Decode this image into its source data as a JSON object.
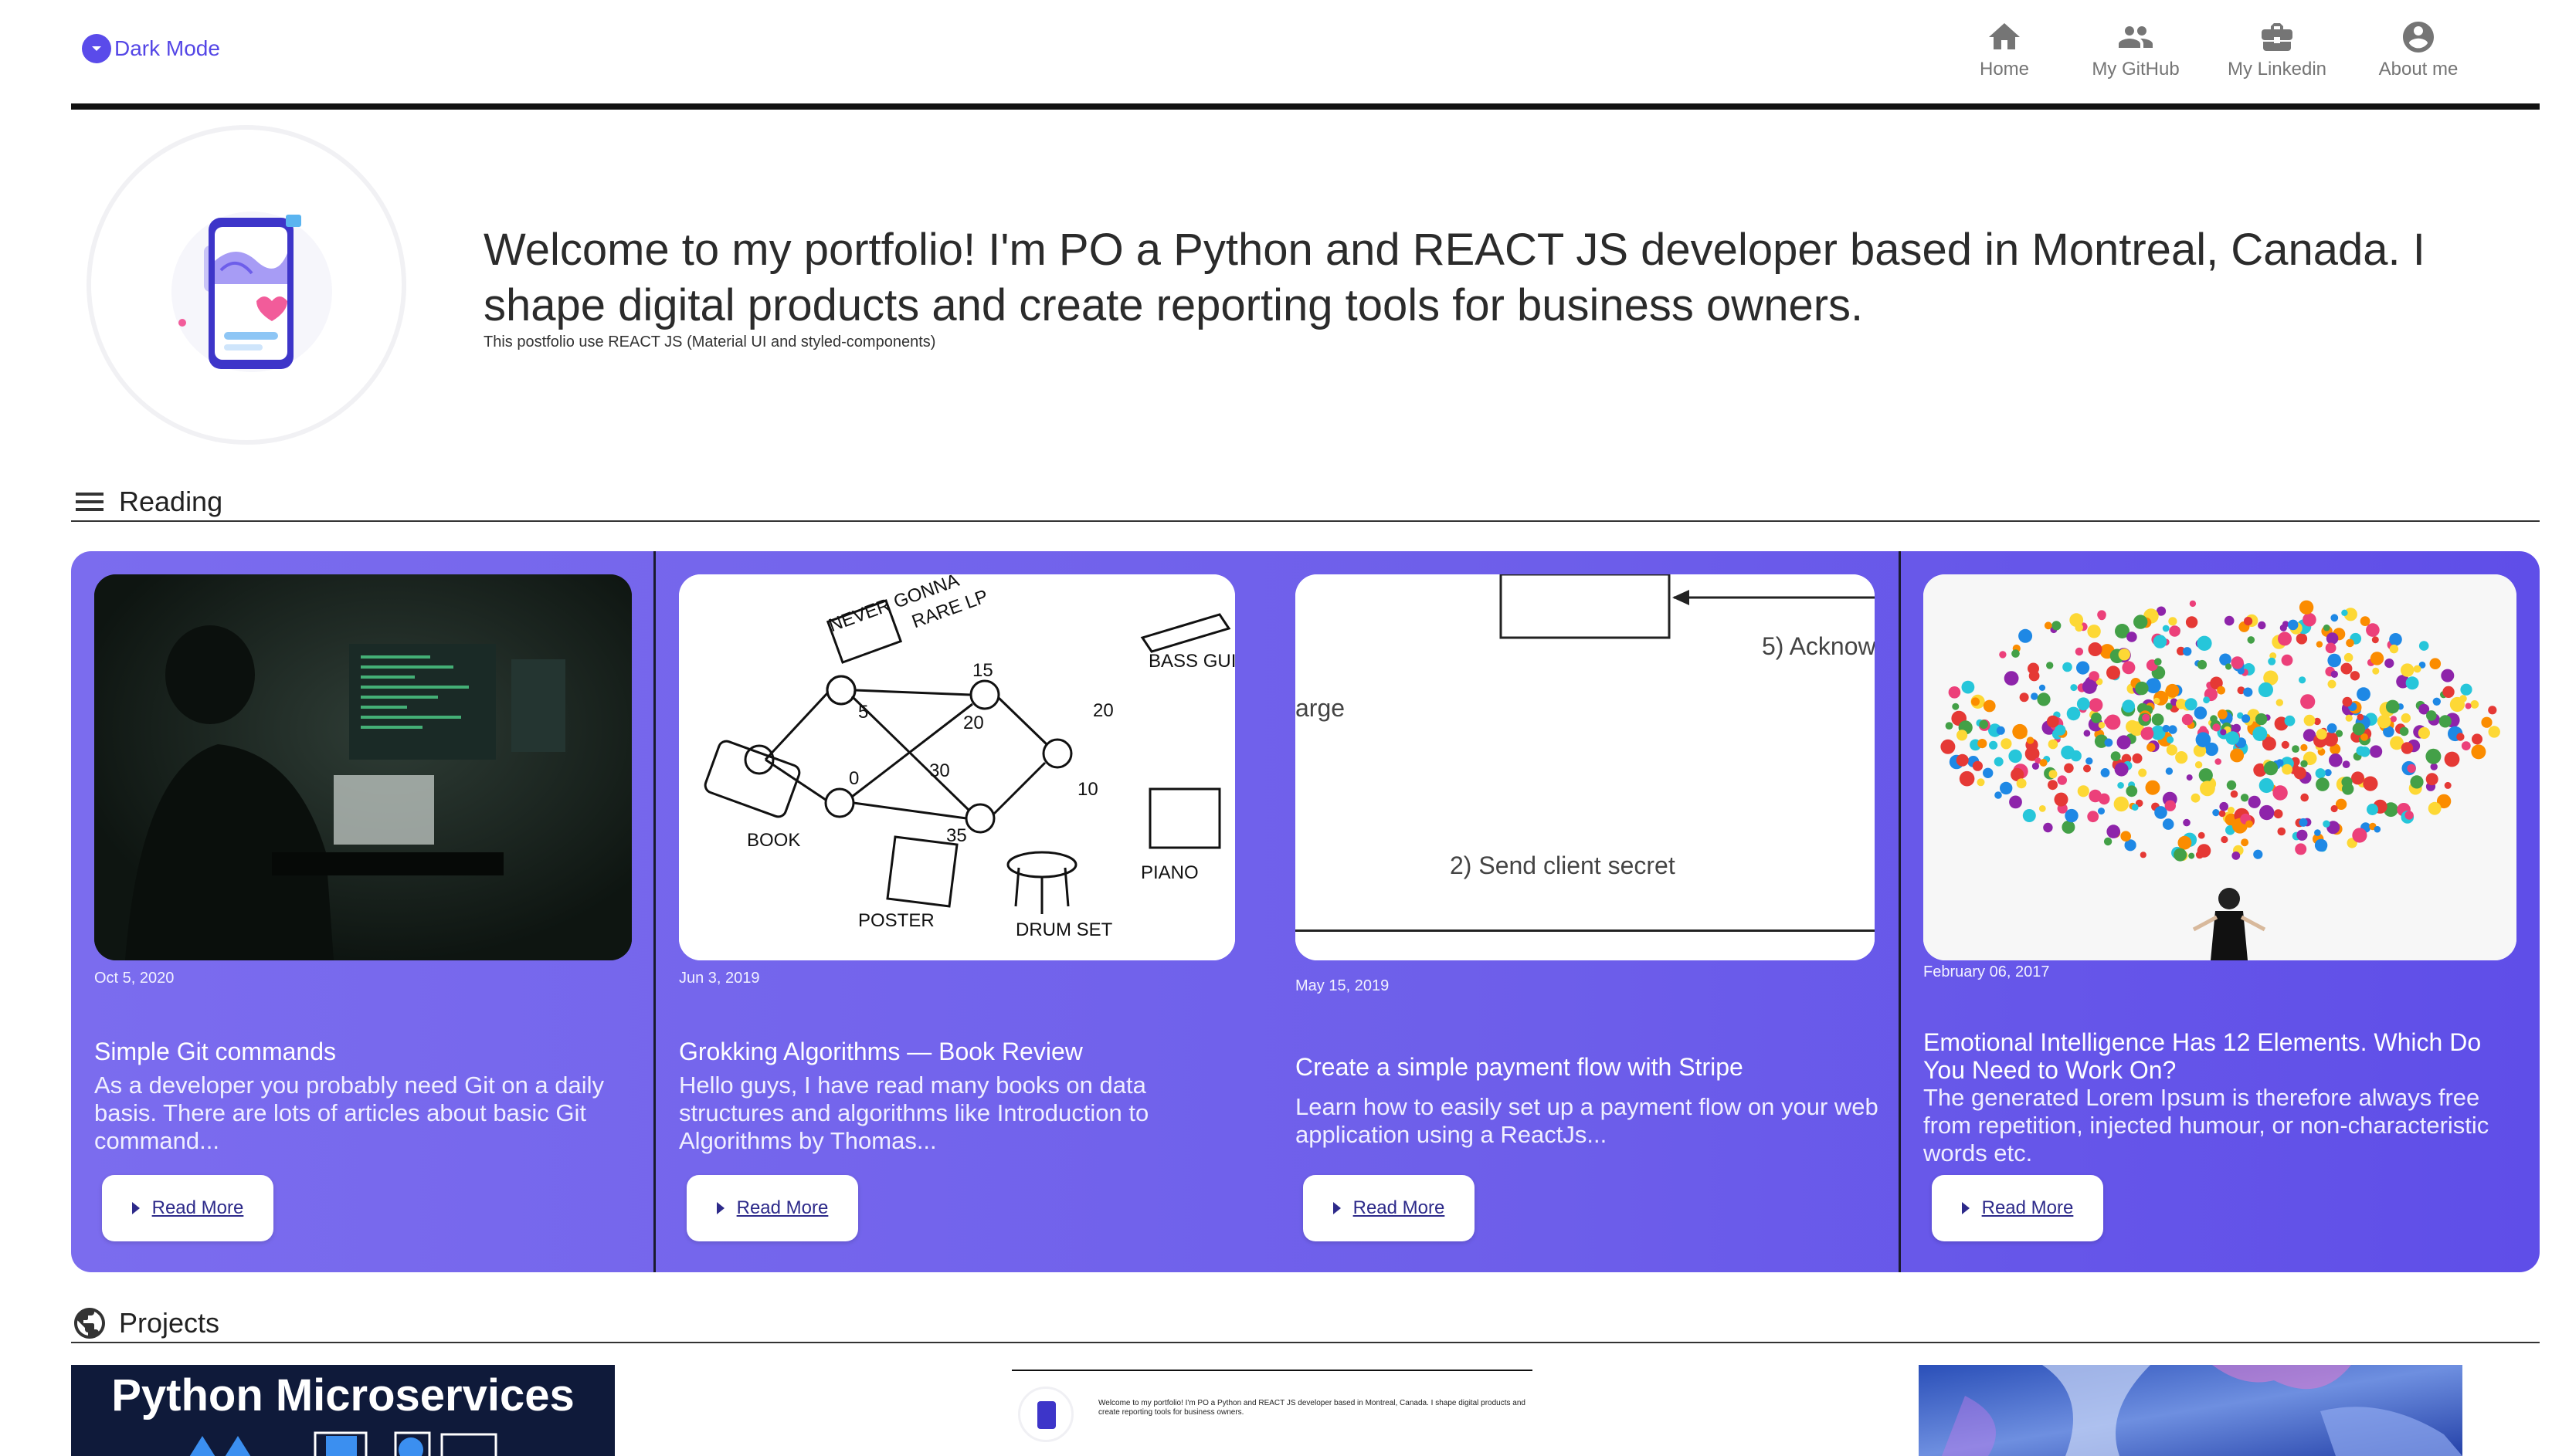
{
  "header": {
    "dark_mode_label": "Dark Mode",
    "nav": [
      {
        "label": "Home",
        "icon": "home-icon"
      },
      {
        "label": "My GitHub",
        "icon": "people-icon"
      },
      {
        "label": "My Linkedin",
        "icon": "briefcase-icon"
      },
      {
        "label": "About me",
        "icon": "account-circle-icon"
      }
    ]
  },
  "hero": {
    "title": "Welcome to my portfolio! I'm PO a Python and REACT JS developer based in Montreal, Canada. I shape digital products and create reporting tools for business owners.",
    "subtitle": "This postfolio use REACT JS (Material UI and styled-components)"
  },
  "reading": {
    "section_title": "Reading",
    "cards": [
      {
        "date": "Oct 5, 2020",
        "title": "Simple Git commands",
        "description": "As a developer you probably need Git on a daily basis. There are lots of articles about basic Git command...",
        "button": "Read More"
      },
      {
        "date": "Jun 3, 2019",
        "title": "Grokking Algorithms — Book Review",
        "description": "Hello guys, I have read many books on data structures and algorithms like Introduction to Algorithms by Thomas...",
        "button": "Read More",
        "image_text": [
          "NEVER GONNA",
          "RARE LP",
          "BASS GUITAR",
          "15",
          "5",
          "20",
          "20",
          "30",
          "0",
          "10",
          "35",
          "BOOK",
          "PIANO",
          "POSTER",
          "DRUM SET"
        ]
      },
      {
        "date": "May 15, 2019",
        "title": "Create a simple payment flow with Stripe",
        "description": "Learn how to easily set up a payment flow on your web application using a ReactJs...",
        "button": "Read More",
        "image_text": [
          "5) Acknow",
          "arge",
          "2) Send client secret"
        ]
      },
      {
        "date": "February 06, 2017",
        "title": "Emotional Intelligence Has 12 Elements. Which Do You Need to Work On?",
        "description": "The generated Lorem Ipsum is therefore always free from repetition, injected humour, or non-characteristic words etc.",
        "button": "Read More"
      }
    ]
  },
  "projects": {
    "section_title": "Projects",
    "items": [
      {
        "thumb_title": "Python Microservices"
      },
      {
        "thumb_title": "Welcome to my portfolio! I'm PO a Python and REACT JS developer based in Montreal, Canada. I shape digital products and create reporting tools for business owners."
      },
      {
        "thumb_title": ""
      }
    ]
  },
  "colors": {
    "accent": "#5a4bea",
    "panel_start": "#7b6cee",
    "panel_end": "#5f4ee8"
  }
}
